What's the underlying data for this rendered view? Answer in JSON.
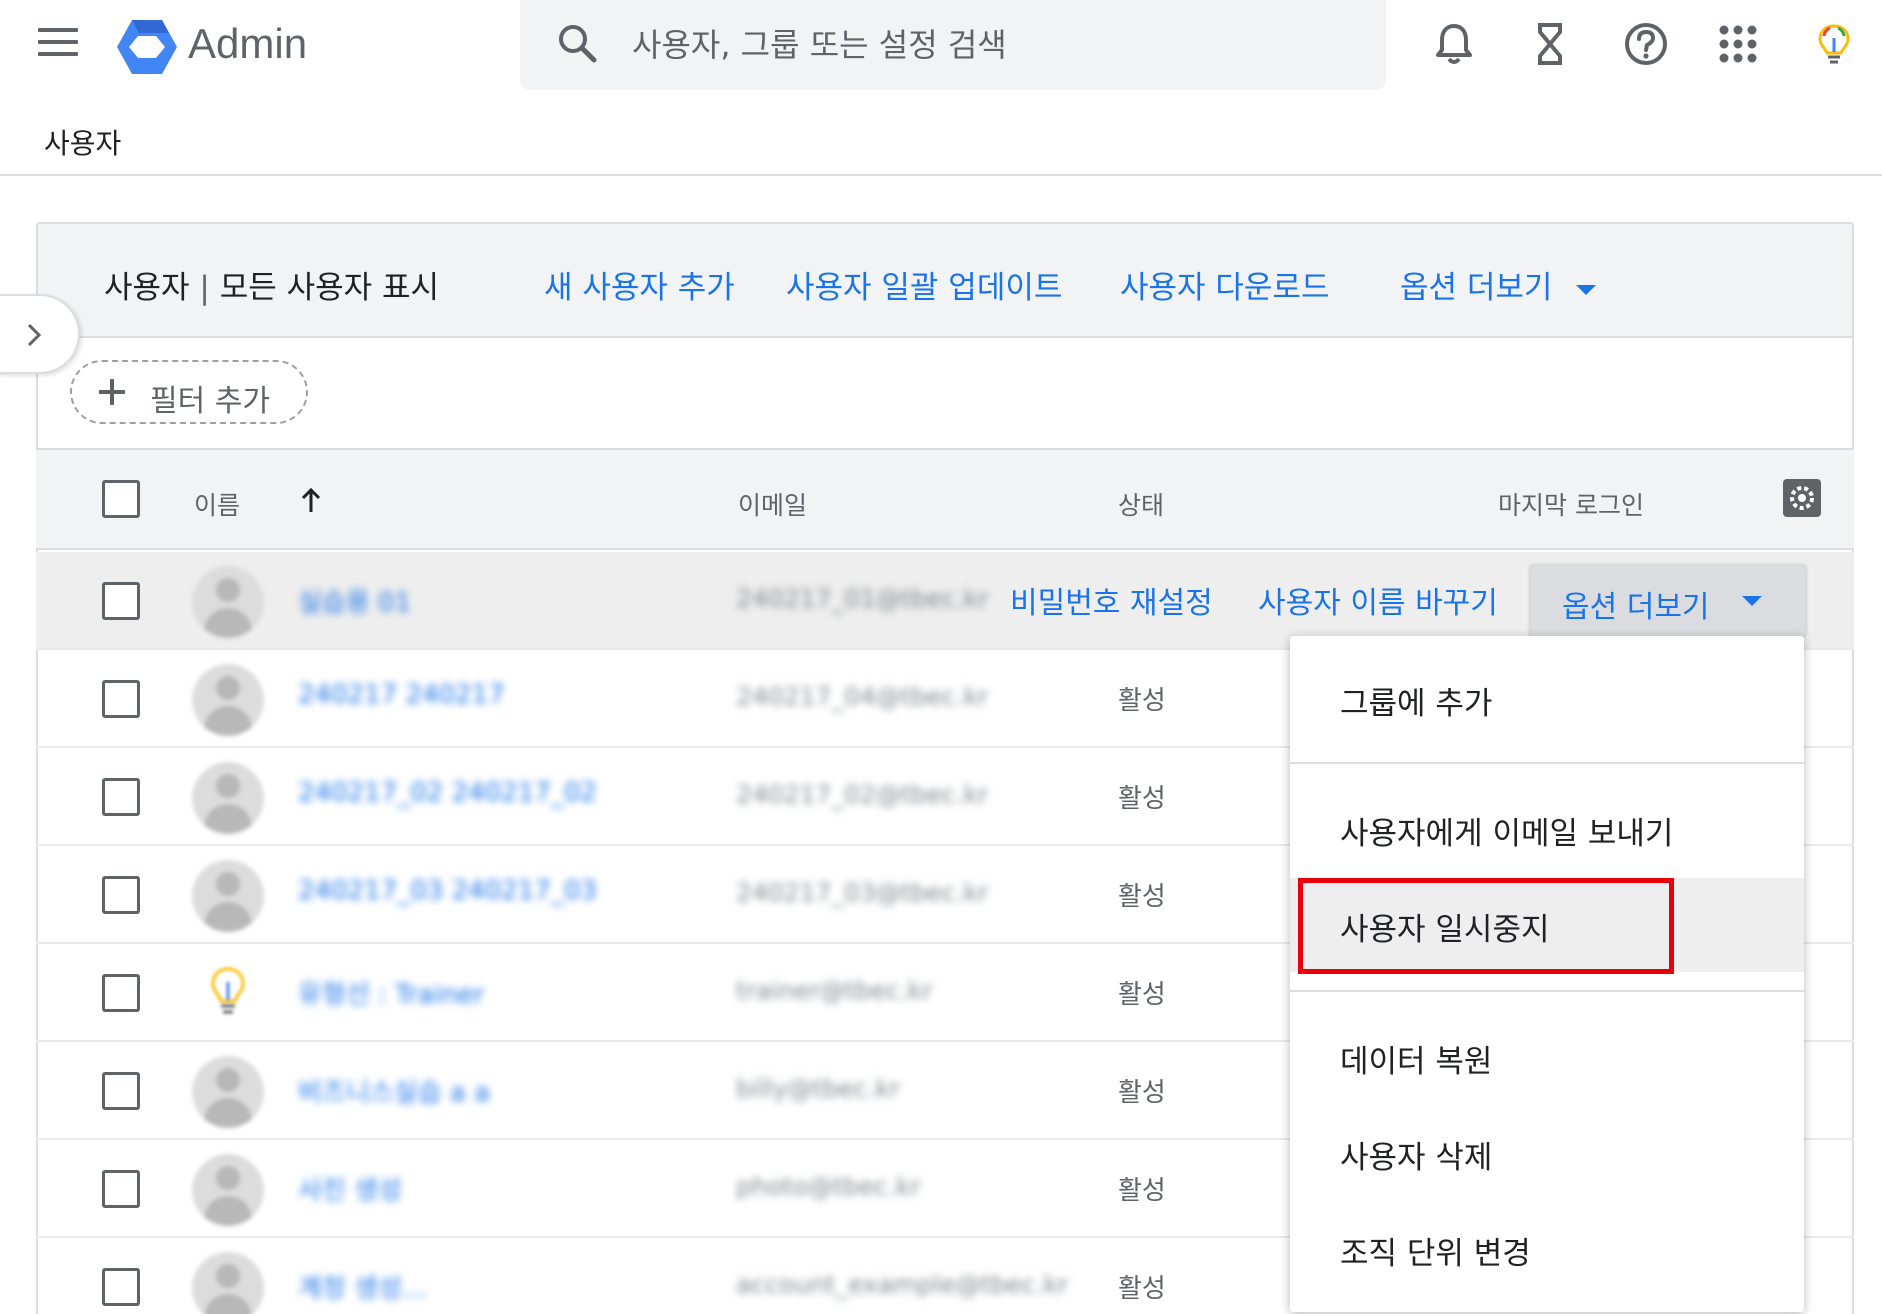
{
  "header": {
    "app_title": "Admin",
    "search_placeholder": "사용자, 그룹 또는 설정 검색",
    "icons": [
      "notifications-icon",
      "hourglass-icon",
      "help-icon",
      "apps-icon",
      "lightbulb-icon"
    ]
  },
  "breadcrumb": {
    "title": "사용자"
  },
  "toolbar": {
    "title_main": "사용자",
    "title_sep": " | ",
    "title_sub": "모든 사용자 표시",
    "add_user": "새 사용자 추가",
    "bulk_update": "사용자 일괄 업데이트",
    "download": "사용자 다운로드",
    "more_options": "옵션 더보기"
  },
  "filter": {
    "add_label": "필터 추가"
  },
  "table": {
    "columns": {
      "name": "이름",
      "email": "이메일",
      "status": "상태",
      "last_login": "마지막 로그인"
    },
    "rows": [
      {
        "name": "실습용 01",
        "email": "240217_01@tbec.kr",
        "status": ""
      },
      {
        "name": "240217 240217",
        "email": "240217_04@tbec.kr",
        "status": "활성"
      },
      {
        "name": "240217_02 240217_02",
        "email": "240217_02@tbec.kr",
        "status": "활성"
      },
      {
        "name": "240217_03 240217_03",
        "email": "240217_03@tbec.kr",
        "status": "활성"
      },
      {
        "name": "유형선 : Trainer",
        "email": "trainer@tbec.kr",
        "status": "활성"
      },
      {
        "name": "비즈니스실습 a a",
        "email": "billy@tbec.kr",
        "status": "활성"
      },
      {
        "name": "사진 생성",
        "email": "photo@tbec.kr",
        "status": "활성"
      },
      {
        "name": "계정 생성...",
        "email": "account_example@tbec.kr",
        "status": "활성"
      }
    ]
  },
  "row_actions": {
    "reset_password": "비밀번호 재설정",
    "rename_user": "사용자 이름 바꾸기",
    "more_options": "옵션 더보기"
  },
  "dropdown": {
    "items": [
      "그룹에 추가",
      "사용자에게 이메일 보내기",
      "사용자 일시중지",
      "데이터 복원",
      "사용자 삭제",
      "조직 단위 변경"
    ],
    "highlighted_index": 2
  },
  "colors": {
    "accent": "#1a73e8",
    "highlight_border": "#e8000b"
  }
}
